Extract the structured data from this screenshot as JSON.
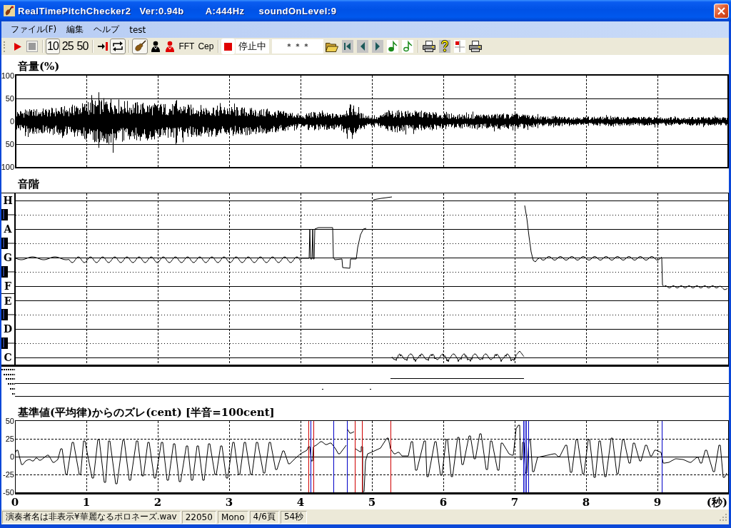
{
  "window": {
    "title": "RealTimePitchChecker2",
    "version": "Ver:0.94b",
    "reference": "A:444Hz",
    "sound_level": "soundOnLevel:9"
  },
  "menu": [
    "ファイル(F)",
    "編集",
    "ヘルプ",
    "test"
  ],
  "toolbar": {
    "rate_buttons": [
      {
        "label": "10",
        "selected": true
      },
      {
        "label": "25",
        "selected": false
      },
      {
        "label": "50",
        "selected": false
      }
    ],
    "loop": {
      "on": true
    },
    "instrument": {
      "on": true
    },
    "analysis_buttons": [
      "FFT",
      "Cep"
    ],
    "status": "停止中",
    "display": "＊＊＊"
  },
  "volume": {
    "title": "音量(%)",
    "yticks": [
      "100",
      "50",
      "0",
      "50",
      "100"
    ]
  },
  "pitch": {
    "title": "音階",
    "keys": [
      {
        "kind": "natural",
        "label": "H"
      },
      {
        "kind": "sharp"
      },
      {
        "kind": "natural",
        "label": "A"
      },
      {
        "kind": "sharp"
      },
      {
        "kind": "natural",
        "label": "G"
      },
      {
        "kind": "sharp"
      },
      {
        "kind": "natural",
        "label": "F"
      },
      {
        "kind": "natural",
        "label": "E"
      },
      {
        "kind": "sharp"
      },
      {
        "kind": "natural",
        "label": "D"
      },
      {
        "kind": "sharp"
      },
      {
        "kind": "natural",
        "label": "C"
      }
    ]
  },
  "deviation": {
    "chart_data": {
      "type": "line",
      "title": "基準値(平均律)からのズレ(cent) [半音=100cent]",
      "xlabel": "(秒)",
      "xlim": [
        0,
        10
      ],
      "ylim": [
        -50,
        50
      ],
      "xticks": [
        0,
        1,
        2,
        3,
        4,
        5,
        6,
        7,
        8,
        9
      ],
      "yticks": [
        50,
        25,
        0,
        -25,
        -50
      ],
      "x": [
        0,
        0.03,
        0.09,
        0.11,
        0.15,
        0.2,
        0.24,
        0.26,
        0.3,
        0.34,
        0.36,
        0.4,
        0.46,
        0.53,
        0.55,
        0.6,
        0.64,
        0.66,
        0.72,
        0.8,
        0.82,
        0.91,
        0.96,
        0.98,
        1.09,
        1.16,
        1.18,
        1.26,
        1.31,
        1.33,
        1.42,
        1.51,
        1.53,
        1.61,
        1.7,
        1.72,
        1.79,
        1.86,
        1.88,
        1.96,
        2.05,
        2.07,
        2.14,
        2.22,
        2.24,
        2.31,
        2.4,
        2.42,
        2.48,
        2.55,
        2.57,
        2.64,
        2.71,
        2.73,
        2.81,
        2.88,
        2.9,
        2.97,
        3.05,
        3.07,
        3.14,
        3.21,
        3.23,
        3.31,
        3.38,
        3.4,
        3.49,
        3.56,
        3.58,
        3.66,
        3.75,
        3.77,
        3.84,
        3.92,
        4,
        4.09,
        4.12,
        4.16,
        4.18,
        4.22,
        4.29,
        4.36,
        4.42,
        4.49,
        4.54,
        4.64,
        4.65,
        4.66,
        4.7,
        4.75,
        4.76,
        4.77,
        4.84,
        4.86,
        4.88,
        4.91,
        4.94,
        4.99,
        5.12,
        5.22,
        5.26,
        5.32,
        5.37,
        5.42,
        5.51,
        5.55,
        5.57,
        5.62,
        5.73,
        5.75,
        5.78,
        5.88,
        5.9,
        5.97,
        6.04,
        6.06,
        6.12,
        6.2,
        6.22,
        6.27,
        6.36,
        6.38,
        6.44,
        6.51,
        6.53,
        6.61,
        6.66,
        6.68,
        6.77,
        6.82,
        6.92,
        6.97,
        7.02,
        7.06,
        7.09,
        7.12,
        7.16,
        7.21,
        7.26,
        7.32,
        7.46,
        7.56,
        7.62,
        7.71,
        7.73,
        7.79,
        7.86,
        7.88,
        7.96,
        8.03,
        8.05,
        8.12,
        8.18,
        8.2,
        8.27,
        8.35,
        8.37,
        8.44,
        8.51,
        8.53,
        8.61,
        8.66,
        8.68,
        8.76,
        8.84,
        8.91,
        8.97,
        9.05,
        9.09,
        9.16,
        9.26,
        9.36,
        9.46,
        9.56,
        9.61,
        9.68,
        9.79,
        9.87,
        9.93,
        9.97
      ],
      "series": [
        {
          "color": "#000000",
          "values": [
            4,
            9,
            -11,
            -11,
            -6,
            -4,
            -6,
            -6,
            -2,
            -5,
            -5,
            -2,
            2,
            -8,
            -8,
            -4,
            11,
            11,
            -25,
            20,
            20,
            -25,
            22,
            22,
            -30,
            24,
            24,
            -36,
            22,
            22,
            -38,
            23,
            23,
            -33,
            22,
            22,
            -27,
            20,
            20,
            -30,
            20,
            20,
            -33,
            18,
            18,
            -35,
            15,
            15,
            -33,
            15,
            15,
            -33,
            18,
            18,
            -25,
            15,
            15,
            -30,
            20,
            20,
            -25,
            20,
            20,
            -25,
            20,
            20,
            -23,
            20,
            20,
            -18,
            8,
            8,
            -10,
            -3,
            4,
            9,
            14,
            -6,
            14,
            16,
            21,
            17,
            19,
            11,
            4,
            16,
            null,
            38,
            33,
            35,
            null,
            11,
            7,
            14,
            -49,
            -6,
            4,
            6,
            12,
            26,
            11,
            4,
            6,
            1,
            1,
            21,
            21,
            -19,
            22,
            22,
            -28,
            21,
            21,
            -26,
            24,
            24,
            -28,
            27,
            27,
            -11,
            29,
            29,
            -3,
            32,
            32,
            -18,
            22,
            22,
            -19,
            19,
            4,
            2,
            39,
            44,
            -4,
            20,
            -23,
            24,
            -21,
            -1,
            2,
            4,
            0,
            16,
            16,
            -22,
            24,
            24,
            -24,
            24,
            24,
            -29,
            22,
            22,
            -28,
            26,
            26,
            -24,
            24,
            24,
            -9,
            19,
            19,
            -6,
            16,
            1,
            9,
            6,
            -9,
            -8,
            -3,
            -4,
            -8,
            -1,
            -9,
            9,
            -21,
            16,
            -29,
            -23
          ]
        }
      ],
      "ref_lines": [
        {
          "axis": "y",
          "value": 25,
          "color": "#000000"
        },
        {
          "axis": "y",
          "value": -25,
          "color": "#000000"
        },
        {
          "axis": "x",
          "value": 1,
          "color": "#000000"
        },
        {
          "axis": "x",
          "value": 2,
          "color": "#000000"
        },
        {
          "axis": "x",
          "value": 3,
          "color": "#000000"
        },
        {
          "axis": "x",
          "value": 4,
          "color": "#000000"
        },
        {
          "axis": "x",
          "value": 5,
          "color": "#000000"
        },
        {
          "axis": "x",
          "value": 6,
          "color": "#000000"
        },
        {
          "axis": "x",
          "value": 7,
          "color": "#000000"
        },
        {
          "axis": "x",
          "value": 8,
          "color": "#000000"
        },
        {
          "axis": "x",
          "value": 9,
          "color": "#000000"
        },
        {
          "axis": "x",
          "value": 4.11,
          "color": "#d00000"
        },
        {
          "axis": "x",
          "value": 4.14,
          "color": "#0000c8"
        },
        {
          "axis": "x",
          "value": 4.18,
          "color": "#d00000"
        },
        {
          "axis": "x",
          "value": 4.46,
          "color": "#0000c8"
        },
        {
          "axis": "x",
          "value": 4.65,
          "color": "#0000c8"
        },
        {
          "axis": "x",
          "value": 4.76,
          "color": "#d00000"
        },
        {
          "axis": "x",
          "value": 4.86,
          "color": "#d00000"
        },
        {
          "axis": "x",
          "value": 5.26,
          "color": "#d00000"
        },
        {
          "axis": "x",
          "value": 7.12,
          "color": "#0000c8"
        },
        {
          "axis": "x",
          "value": 7.14,
          "color": "#0000c8"
        },
        {
          "axis": "x",
          "value": 7.16,
          "color": "#0000c8"
        },
        {
          "axis": "x",
          "value": 7.19,
          "color": "#0000c8"
        },
        {
          "axis": "x",
          "value": 9.06,
          "color": "#0000c8"
        }
      ]
    }
  },
  "status_bar": [
    "演奏者名は非表示¥華麗なるポロネーズ.wav",
    "22050",
    "Mono",
    "4/6頁",
    "54秒"
  ]
}
